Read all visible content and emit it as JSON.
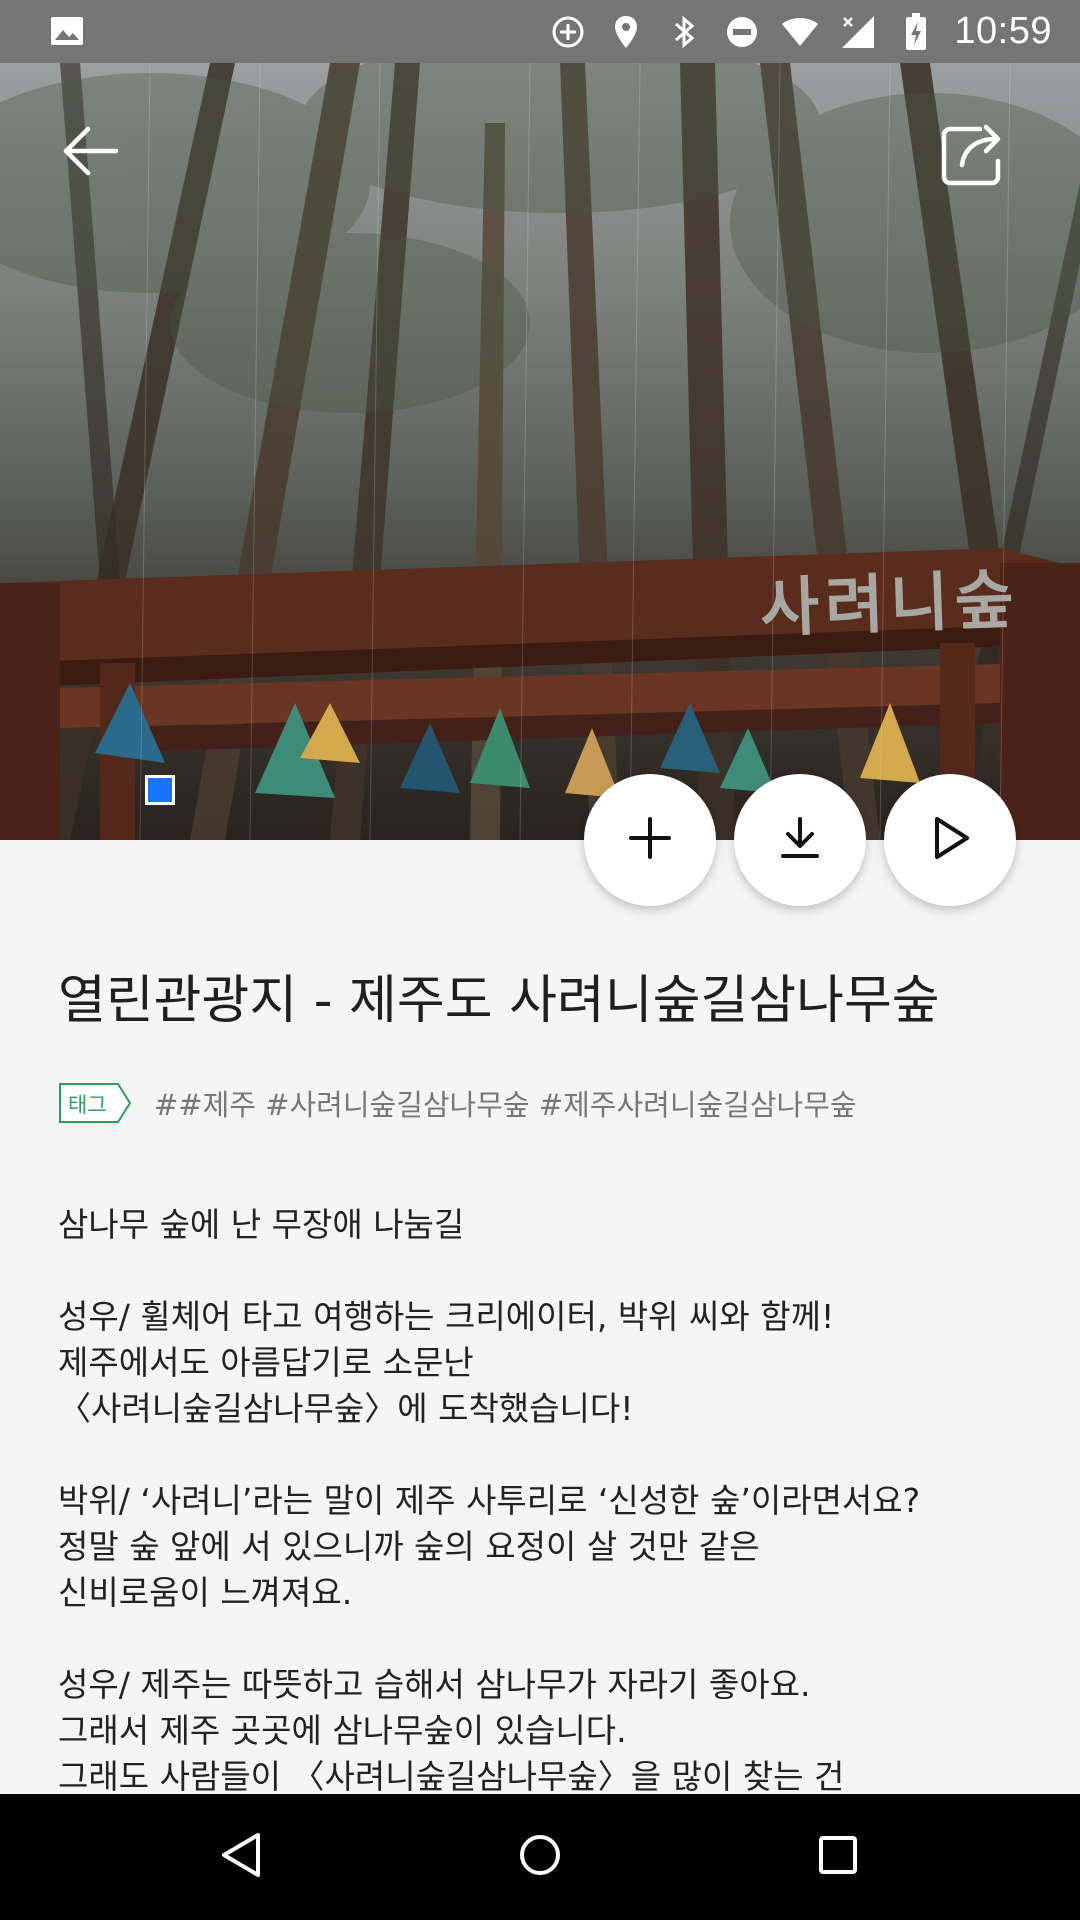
{
  "status_bar": {
    "time": "10:59",
    "icons": [
      "image-icon",
      "add-circle-icon",
      "location-icon",
      "bluetooth-icon",
      "do-not-disturb-icon",
      "wifi-icon",
      "no-signal-icon",
      "battery-charging-icon"
    ]
  },
  "hero": {
    "sign_text": "사려니숲",
    "back_icon": "arrow-left-icon",
    "share_icon": "share-icon"
  },
  "actions": {
    "add_icon": "plus-icon",
    "download_icon": "download-icon",
    "play_icon": "play-icon"
  },
  "content": {
    "title": "열린관광지 - 제주도 사려니숲길삼나무숲",
    "tag_label": "태그",
    "tags": "##제주 #사려니숲길삼나무숲 #제주사려니숲길삼나무숲",
    "paragraphs": [
      [
        "삼나무 숲에 난 무장애 나눔길"
      ],
      [
        "성우/ 휠체어 타고 여행하는 크리에이터, 박위 씨와 함께!",
        "제주에서도 아름답기로 소문난",
        "〈사려니숲길삼나무숲〉에 도착했습니다!"
      ],
      [
        "박위/ ‘사려니’라는 말이 제주 사투리로 ‘신성한 숲’이라면서요?",
        "정말 숲 앞에 서 있으니까 숲의 요정이 살 것만 같은",
        "신비로움이 느껴져요."
      ],
      [
        "성우/ 제주는 따뜻하고 습해서 삼나무가 자라기 좋아요.",
        "그래서 제주 곳곳에 삼나무숲이 있습니다.",
        "그래도 사람들이 〈사려니숲길삼나무숲〉을 많이 찾는 건"
      ]
    ]
  },
  "colors": {
    "tag_green": "#2e9e58",
    "indicator_blue": "#1a73ff"
  },
  "nav_bar": {
    "back_icon": "nav-back-icon",
    "home_icon": "nav-home-icon",
    "recent_icon": "nav-recent-icon"
  }
}
